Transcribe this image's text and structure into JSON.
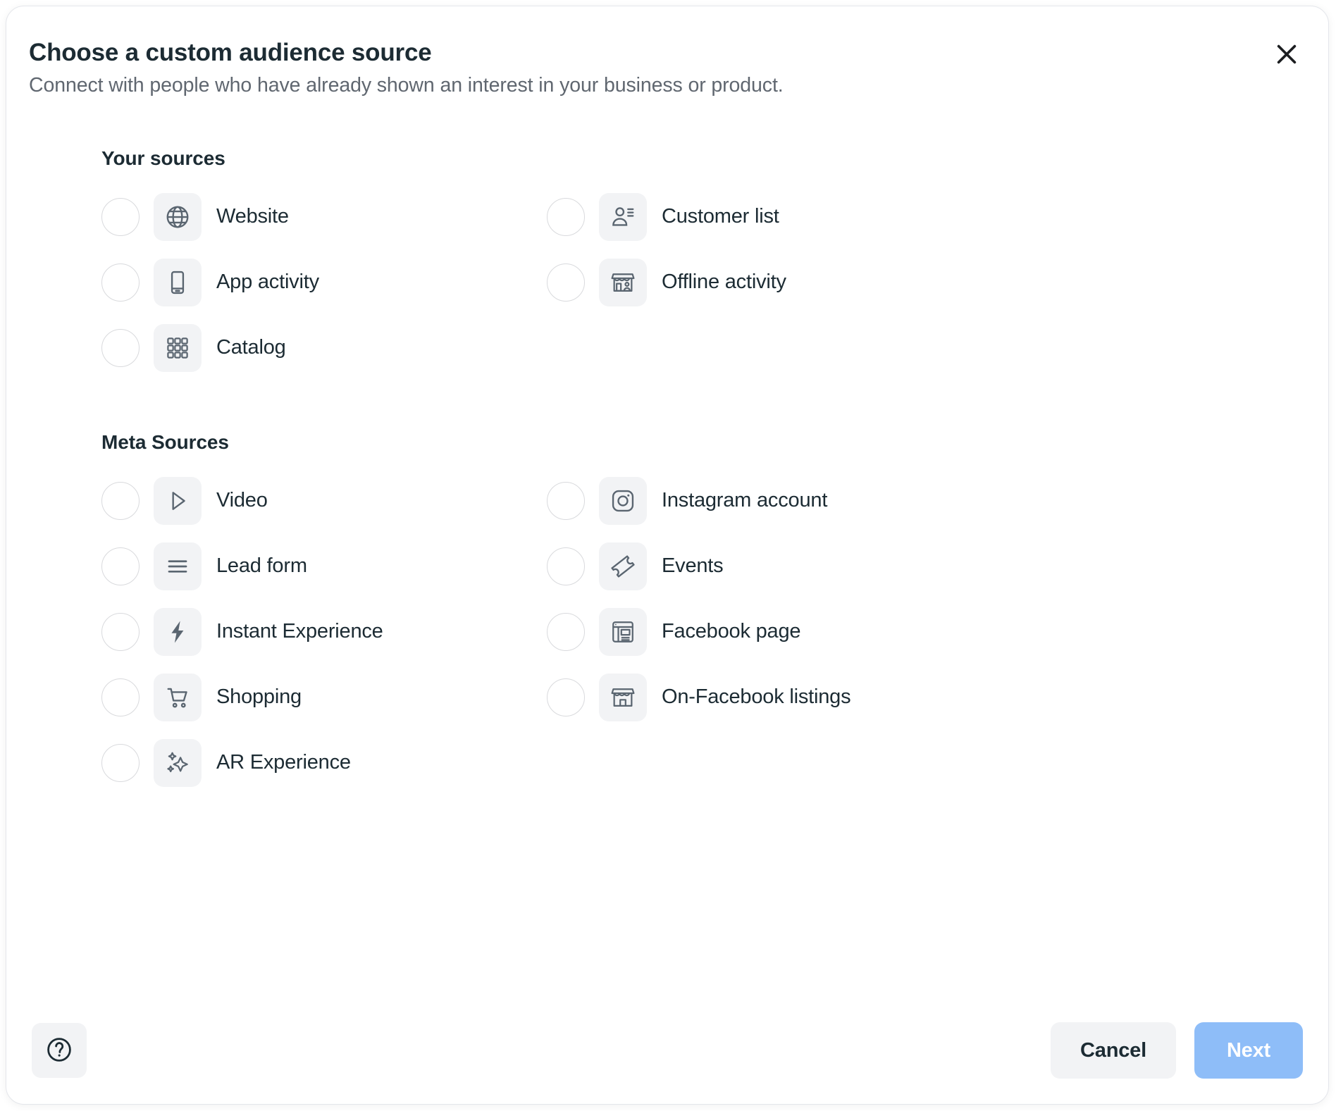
{
  "dialog": {
    "title": "Choose a custom audience source",
    "subtitle": "Connect with people who have already shown an interest in your business or product.",
    "close_label": "Close"
  },
  "sections": [
    {
      "title": "Your sources",
      "options": [
        {
          "label": "Website",
          "icon": "globe-icon",
          "column": "left",
          "selected": false
        },
        {
          "label": "Customer list",
          "icon": "person-list-icon",
          "column": "right",
          "selected": false
        },
        {
          "label": "App activity",
          "icon": "mobile-phone-icon",
          "column": "left",
          "selected": false
        },
        {
          "label": "Offline activity",
          "icon": "storefront-person-icon",
          "column": "right",
          "selected": false
        },
        {
          "label": "Catalog",
          "icon": "grid-icon",
          "column": "left",
          "selected": false
        }
      ]
    },
    {
      "title": "Meta Sources",
      "options": [
        {
          "label": "Video",
          "icon": "play-triangle-icon",
          "column": "left",
          "selected": false
        },
        {
          "label": "Instagram account",
          "icon": "instagram-icon",
          "column": "right",
          "selected": false
        },
        {
          "label": "Lead form",
          "icon": "lines-form-icon",
          "column": "left",
          "selected": false
        },
        {
          "label": "Events",
          "icon": "ticket-icon",
          "column": "right",
          "selected": false
        },
        {
          "label": "Instant Experience",
          "icon": "lightning-bolt-icon",
          "column": "left",
          "selected": false
        },
        {
          "label": "Facebook page",
          "icon": "page-layout-icon",
          "column": "right",
          "selected": false
        },
        {
          "label": "Shopping",
          "icon": "shopping-cart-icon",
          "column": "left",
          "selected": false
        },
        {
          "label": "On-Facebook listings",
          "icon": "storefront-icon",
          "column": "right",
          "selected": false
        },
        {
          "label": "AR Experience",
          "icon": "sparkles-icon",
          "column": "left",
          "selected": false
        }
      ]
    }
  ],
  "footer": {
    "help_label": "Help",
    "cancel_label": "Cancel",
    "next_label": "Next"
  },
  "colors": {
    "title": "#1c2b33",
    "subtitle": "#606770",
    "icon_tile_bg": "#f2f3f5",
    "icon_stroke": "#5a6570",
    "next_button_bg": "#8ebdf8",
    "next_button_text": "#ffffff",
    "cancel_button_bg": "#f2f3f5",
    "radio_border": "#d9dadd"
  }
}
